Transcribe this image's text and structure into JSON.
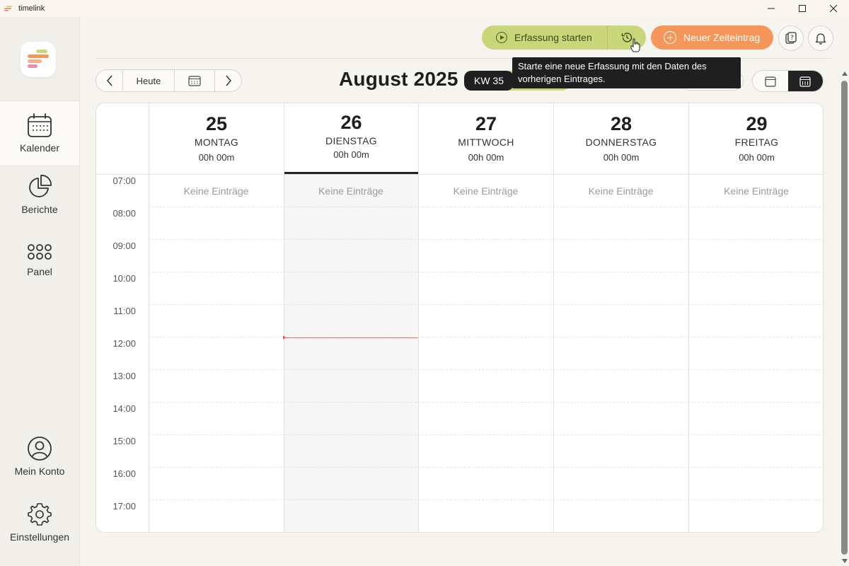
{
  "window": {
    "title": "timelink",
    "minimize": "—",
    "maximize": "☐",
    "close": "✕"
  },
  "sidebar": {
    "items": [
      {
        "label": "Kalender",
        "icon": "calendar-icon"
      },
      {
        "label": "Berichte",
        "icon": "pie-chart-icon"
      },
      {
        "label": "Panel",
        "icon": "grid-dots-icon"
      },
      {
        "label": "Mein Konto",
        "icon": "user-icon"
      },
      {
        "label": "Einstellungen",
        "icon": "gear-icon"
      }
    ]
  },
  "toolbar": {
    "start_label": "Erfassung starten",
    "new_entry_label": "Neuer Zeiteintrag",
    "tooltip": "Starte eine neue Erfassung mit den Daten des vorherigen Eintrages."
  },
  "navigation": {
    "today_label": "Heute",
    "month_title": "August 2025",
    "week_badge": "KW 35"
  },
  "calendar": {
    "days": [
      {
        "num": "25",
        "name": "MONTAG",
        "duration": "00h 00m",
        "empty": "Keine Einträge"
      },
      {
        "num": "26",
        "name": "DIENSTAG",
        "duration": "00h 00m",
        "empty": "Keine Einträge"
      },
      {
        "num": "27",
        "name": "MITTWOCH",
        "duration": "00h 00m",
        "empty": "Keine Einträge"
      },
      {
        "num": "28",
        "name": "DONNERSTAG",
        "duration": "00h 00m",
        "empty": "Keine Einträge"
      },
      {
        "num": "29",
        "name": "FREITAG",
        "duration": "00h 00m",
        "empty": "Keine Einträge"
      }
    ],
    "hours": [
      "07:00",
      "08:00",
      "09:00",
      "10:00",
      "11:00",
      "12:00",
      "13:00",
      "14:00",
      "15:00",
      "16:00",
      "17:00"
    ]
  },
  "colors": {
    "accent_green": "#c9d67a",
    "accent_orange": "#f5975a",
    "now_line": "#f07070"
  }
}
